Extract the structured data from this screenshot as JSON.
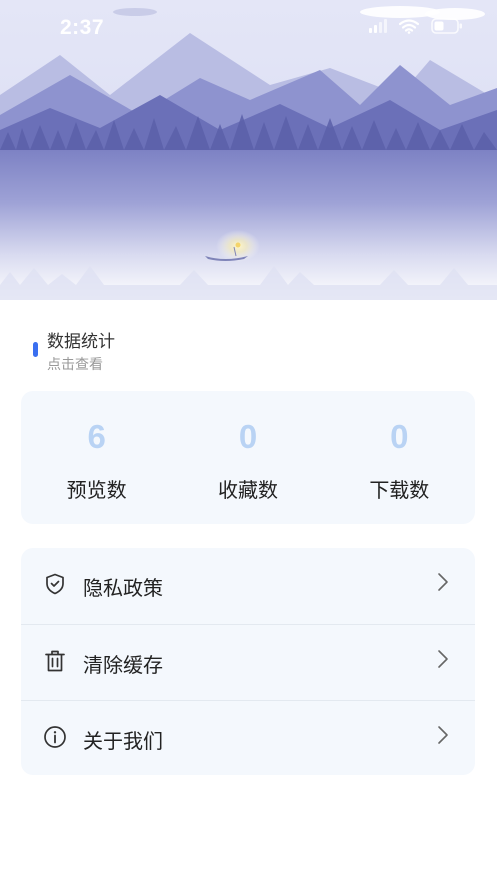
{
  "status_bar": {
    "time": "2:37",
    "icons": [
      "signal-icon",
      "wifi-icon",
      "battery-icon"
    ]
  },
  "stats_section": {
    "title": "数据统计",
    "subtitle": "点击查看",
    "accent_color": "#3a6ff0",
    "items": [
      {
        "value": "6",
        "label": "预览数"
      },
      {
        "value": "0",
        "label": "收藏数"
      },
      {
        "value": "0",
        "label": "下载数"
      }
    ]
  },
  "menu": {
    "items": [
      {
        "label": "隐私政策",
        "icon": "shield-icon"
      },
      {
        "label": "清除缓存",
        "icon": "trash-icon"
      },
      {
        "label": "关于我们",
        "icon": "info-icon"
      }
    ]
  }
}
